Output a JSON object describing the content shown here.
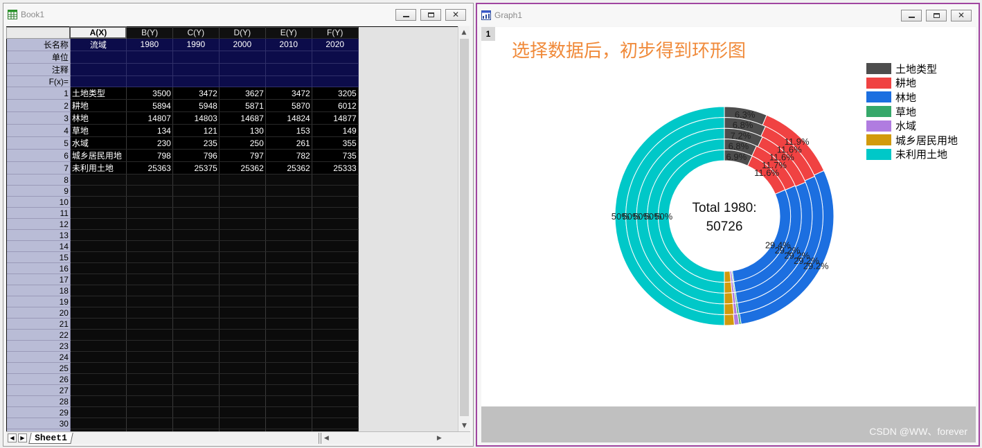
{
  "workbook": {
    "title": "Book1",
    "columns": [
      {
        "label": "A(X)",
        "selected": true
      },
      {
        "label": "B(Y)"
      },
      {
        "label": "C(Y)"
      },
      {
        "label": "D(Y)"
      },
      {
        "label": "E(Y)"
      },
      {
        "label": "F(Y)"
      }
    ],
    "meta_rows": [
      {
        "header": "长名称",
        "cells": [
          "流域",
          "1980",
          "1990",
          "2000",
          "2010",
          "2020"
        ]
      },
      {
        "header": "单位",
        "cells": [
          "",
          "",
          "",
          "",
          "",
          ""
        ]
      },
      {
        "header": "注释",
        "cells": [
          "",
          "",
          "",
          "",
          "",
          ""
        ]
      },
      {
        "header": "F(x)=",
        "cells": [
          "",
          "",
          "",
          "",
          "",
          ""
        ]
      }
    ],
    "data_rows": [
      [
        "土地类型",
        "3500",
        "3472",
        "3627",
        "3472",
        "3205"
      ],
      [
        "耕地",
        "5894",
        "5948",
        "5871",
        "5870",
        "6012"
      ],
      [
        "林地",
        "14807",
        "14803",
        "14687",
        "14824",
        "14877"
      ],
      [
        "草地",
        "134",
        "121",
        "130",
        "153",
        "149"
      ],
      [
        "水域",
        "230",
        "235",
        "250",
        "261",
        "355"
      ],
      [
        "城乡居民用地",
        "798",
        "796",
        "797",
        "782",
        "735"
      ],
      [
        "未利用土地",
        "25363",
        "25375",
        "25362",
        "25362",
        "25333"
      ]
    ],
    "row_numbers_visible": 31,
    "sheet_tab": "Sheet1"
  },
  "graph": {
    "title": "Graph1",
    "layer_number": "1",
    "chart_title": "选择数据后，初步得到环形图",
    "center_label_line1": "Total 1980:",
    "center_label_line2": "50726",
    "watermark": "CSDN @WW、forever"
  },
  "chart_data": {
    "type": "pie",
    "subtype": "donut-multi-ring",
    "title": "选择数据后，初步得到环形图",
    "categories": [
      "土地类型",
      "耕地",
      "林地",
      "草地",
      "水域",
      "城乡居民用地",
      "未利用土地"
    ],
    "colors": [
      "#4d4d4d",
      "#f04242",
      "#1c6fe0",
      "#36a86a",
      "#b07ce0",
      "#d29a0c",
      "#00c8c8"
    ],
    "series": [
      {
        "name": "1980",
        "values": [
          3500,
          5894,
          14807,
          134,
          230,
          798,
          25363
        ]
      },
      {
        "name": "1990",
        "values": [
          3472,
          5948,
          14803,
          121,
          235,
          796,
          25375
        ]
      },
      {
        "name": "2000",
        "values": [
          3627,
          5871,
          14687,
          130,
          250,
          797,
          25362
        ]
      },
      {
        "name": "2010",
        "values": [
          3472,
          5870,
          14824,
          153,
          261,
          782,
          25362
        ]
      },
      {
        "name": "2020",
        "values": [
          3205,
          6012,
          14877,
          149,
          355,
          735,
          25333
        ]
      }
    ],
    "ring_order": "outer-to-inner: 2020, 2010, 2000, 1990, 1980",
    "slice_labels": {
      "土地类型": [
        "6.3%",
        "6.8%",
        "7.2%",
        "6.8%",
        "6.9%"
      ],
      "耕地": [
        "11.9%",
        "11.6%",
        "11.6%",
        "11.7%",
        "11.6%"
      ],
      "林地": [
        "29.2%",
        "29.2%",
        "29.2%",
        "29.2%",
        "29.4%"
      ],
      "未利用土地": [
        "50%",
        "50%",
        "50%",
        "50%",
        "50%"
      ]
    },
    "center_text": [
      "Total 1980:",
      "50726"
    ],
    "legend_position": "top-right"
  }
}
